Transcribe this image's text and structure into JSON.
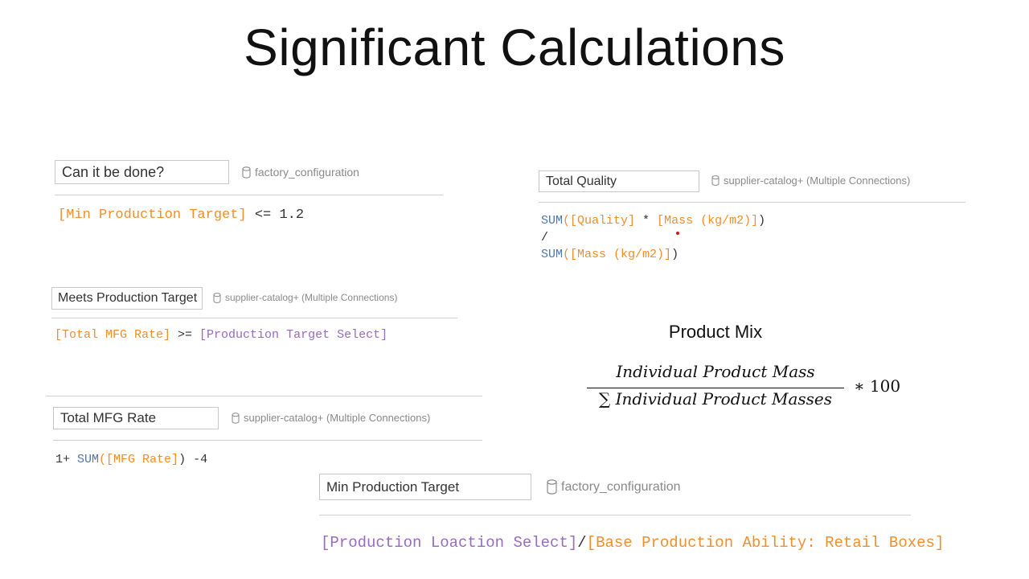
{
  "slide": {
    "title": "Significant Calculations"
  },
  "calc_can_it_be_done": {
    "name": "Can it be done?",
    "datasource": "factory_configuration",
    "formula": {
      "t1": "[Min Production Target]",
      "t2": " <= 1.2"
    }
  },
  "calc_meets_target": {
    "name": "Meets Production Target",
    "datasource": "supplier-catalog+ (Multiple Connections)",
    "formula": {
      "t1": "[Total MFG Rate]",
      "t2": " >= ",
      "t3": "[Production Target Select]"
    }
  },
  "calc_total_mfg_rate": {
    "name": "Total MFG Rate",
    "datasource": "supplier-catalog+ (Multiple Connections)",
    "formula": {
      "t1": "1+ ",
      "t2": "SUM",
      "t3": "(",
      "t4": "[MFG Rate]",
      "t5": ") -4"
    }
  },
  "calc_total_quality": {
    "name": "Total Quality",
    "datasource": "supplier-catalog+ (Multiple Connections)",
    "formula": {
      "l1_fn": "SUM",
      "l1_p1": "(",
      "l1_f1": "[Quality]",
      "l1_op": " * ",
      "l1_f2": "[Mass (kg/m2)]",
      "l1_p2": ")",
      "l2": "/",
      "l3_fn": "SUM",
      "l3_p1": "(",
      "l3_f1": "[Mass (kg/m2)]",
      "l3_p2": ")"
    }
  },
  "product_mix": {
    "title": "Product Mix",
    "numerator": "Individual Product Mass",
    "denominator": "∑ Individual Product Masses",
    "multiplier": "∗ 100"
  },
  "calc_min_production_target": {
    "name": "Min Production Target",
    "datasource": "factory_configuration",
    "formula": {
      "t1": "[Production Loaction Select]",
      "t2": "/",
      "t3": "[Base Production Ability: Retail Boxes]"
    }
  },
  "colors": {
    "field": "#f28e2b",
    "parameter": "#9a6ac1",
    "function": "#4e79a7",
    "operator": "#333333",
    "spellcheck_dot": "#e01010"
  },
  "icons": {
    "datasource": "database-cylinder-icon"
  }
}
